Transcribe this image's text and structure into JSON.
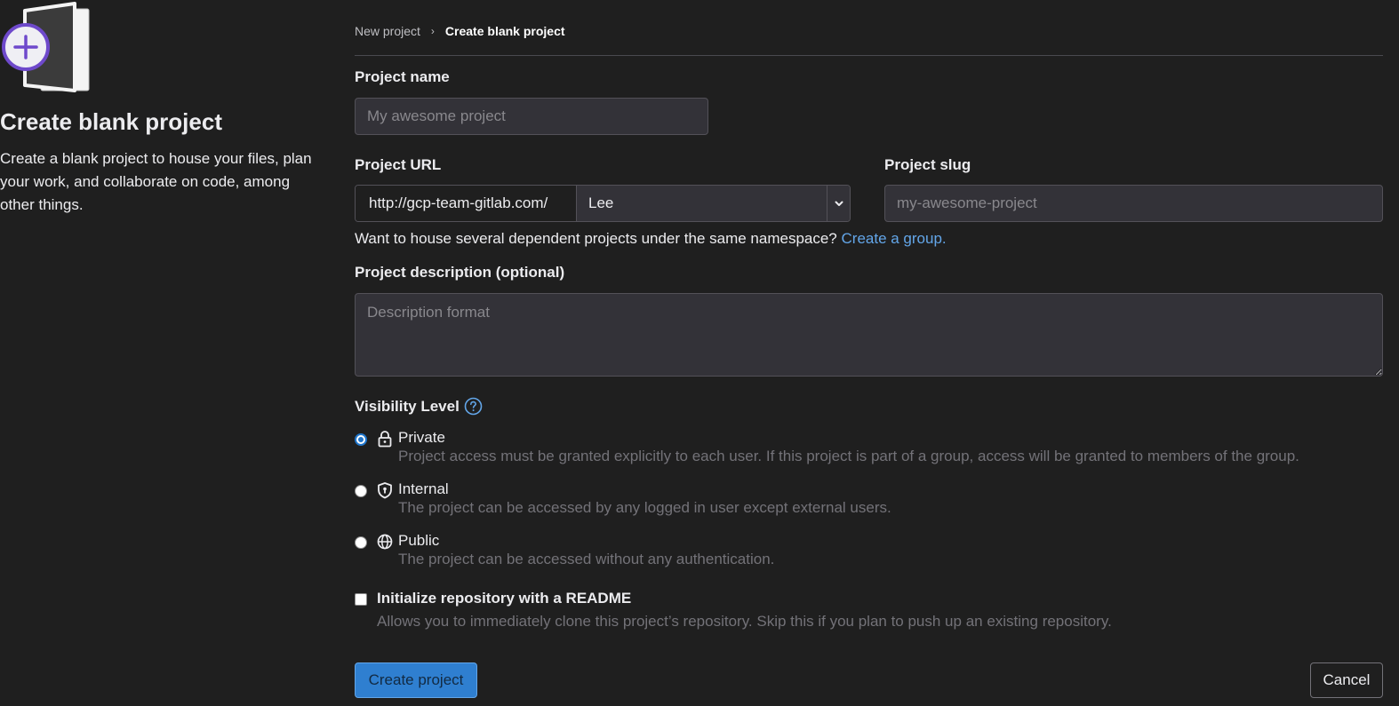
{
  "left": {
    "title": "Create blank project",
    "description": "Create a blank project to house your files, plan your work, and collaborate on code, among other things."
  },
  "breadcrumb": {
    "parent": "New project",
    "current": "Create blank project"
  },
  "form": {
    "project_name_label": "Project name",
    "project_name_placeholder": "My awesome project",
    "project_url_label": "Project URL",
    "url_prefix": "http://gcp-team-gitlab.com/",
    "namespace": "Lee",
    "project_slug_label": "Project slug",
    "project_slug_placeholder": "my-awesome-project",
    "group_help": "Want to house several dependent projects under the same namespace?",
    "group_link": "Create a group.",
    "description_label": "Project description (optional)",
    "description_placeholder": "Description format",
    "visibility_label": "Visibility Level",
    "visibility_options": [
      {
        "title": "Private",
        "description": "Project access must be granted explicitly to each user. If this project is part of a group, access will be granted to members of the group.",
        "icon": "lock-icon",
        "selected": true
      },
      {
        "title": "Internal",
        "description": "The project can be accessed by any logged in user except external users.",
        "icon": "shield-icon",
        "selected": false
      },
      {
        "title": "Public",
        "description": "The project can be accessed without any authentication.",
        "icon": "globe-icon",
        "selected": false
      }
    ],
    "readme_label": "Initialize repository with a README",
    "readme_description": "Allows you to immediately clone this project’s repository. Skip this if you plan to push up an existing repository.",
    "readme_checked": false
  },
  "actions": {
    "create": "Create project",
    "cancel": "Cancel"
  },
  "colors": {
    "background": "#1f1f1f",
    "accent": "#1f75cb",
    "link": "#63a6e9",
    "illustration_purple": "#6e49cb"
  }
}
